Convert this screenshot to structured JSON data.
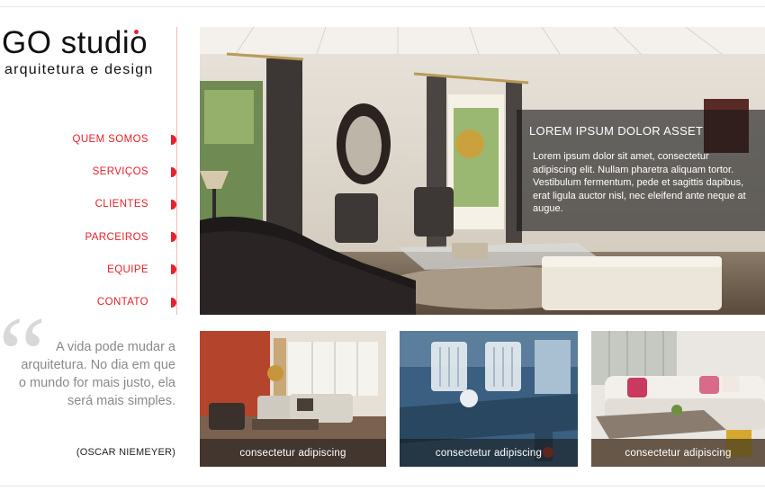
{
  "brand": {
    "title": "GO studio",
    "subtitle": "arquitetura e design",
    "accent_color": "#e8202a"
  },
  "nav": {
    "items": [
      {
        "label": "QUEM SOMOS"
      },
      {
        "label": "SERVIÇOS"
      },
      {
        "label": "CLIENTES"
      },
      {
        "label": "PARCEIROS"
      },
      {
        "label": "EQUIPE"
      },
      {
        "label": "CONTATO"
      }
    ],
    "bullet_icon": "half-circle-bullet"
  },
  "quote": {
    "mark": "“",
    "text": "A vida pode mudar a arquitetura. No dia em que o mundo for mais justo, ela será mais simples.",
    "author": "(OSCAR NIEMEYER)"
  },
  "hero": {
    "title": "LOREM IPSUM DOLOR ASSET",
    "body": "Lorem ipsum dolor sit amet, consectetur adipiscing elit. Nullam pharetra aliquam tortor. Vestibulum fermentum, pede et sagittis dapibus, erat ligula auctor nisl, nec eleifend ante neque at augue."
  },
  "thumbnails": [
    {
      "caption": "consectetur adipiscing"
    },
    {
      "caption": "consectetur adipiscing"
    },
    {
      "caption": "consectetur adipiscing"
    }
  ]
}
